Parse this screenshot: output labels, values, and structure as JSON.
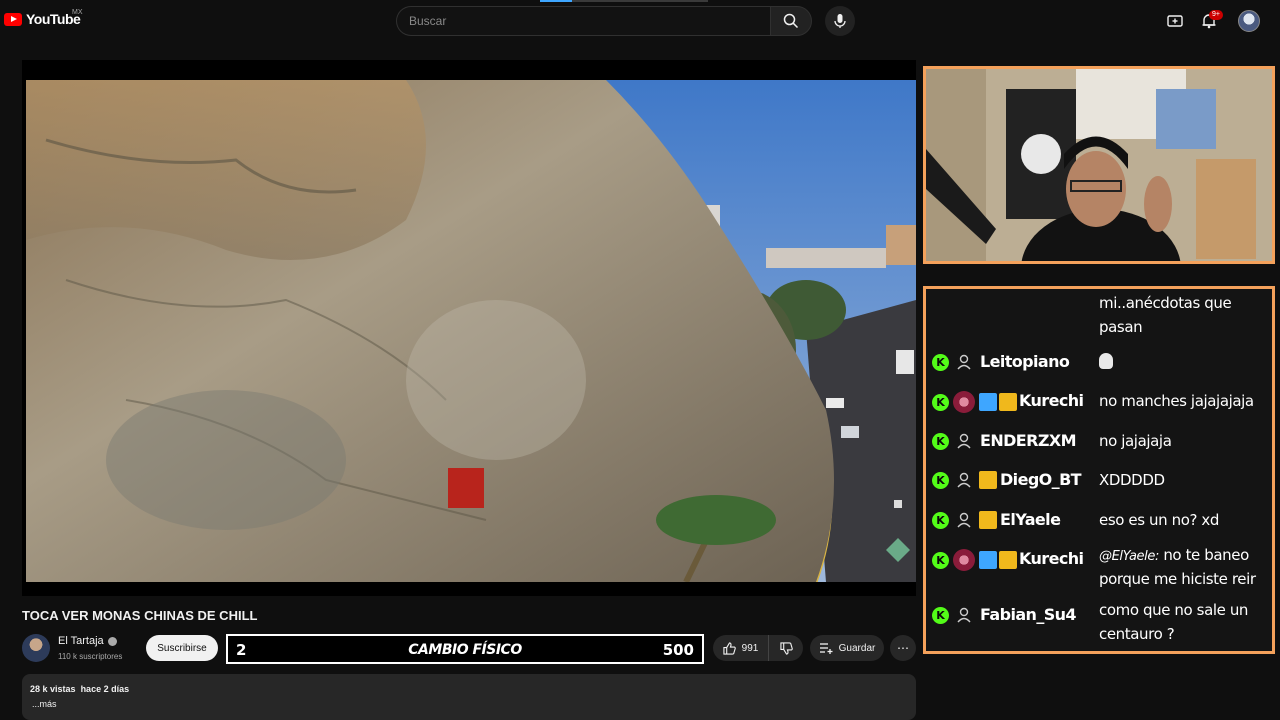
{
  "header": {
    "logo_text": "YouTube",
    "region": "MX",
    "search_placeholder": "Buscar",
    "notif_count": "9+"
  },
  "video": {
    "title": "TOCA VER MONAS CHINAS DE CHILL",
    "channel_name": "El Tartaja",
    "subscribers": "110 k suscriptores",
    "subscribe_label": "Suscribirse",
    "likes": "991",
    "save_label": "Guardar",
    "views": "28 k vistas",
    "age": "hace 2 días",
    "more_label": "...más"
  },
  "overlay_bar": {
    "left": "2",
    "center": "CAMBIO FÍSICO",
    "right": "500"
  },
  "chat": {
    "continuation": [
      "mi..anécdotas que",
      "pasan"
    ],
    "messages": [
      {
        "user": "Leitopiano",
        "text": "",
        "emote": true
      },
      {
        "user": "Kurechi",
        "text": "no manches jajajajaja"
      },
      {
        "user": "ENDERZXM",
        "text": "no jajajaja"
      },
      {
        "user": "DiegO_BT",
        "text": "XDDDDD"
      },
      {
        "user": "ElYaele",
        "text": "eso es un no? xd"
      },
      {
        "user": "Kurechi",
        "mention": "@ElYaele:",
        "text": "no te baneo",
        "text2": "porque me hiciste reir"
      },
      {
        "user": "Fabian_Su4",
        "text": "como que no sale un",
        "text2": "centauro ?"
      }
    ]
  },
  "icons": [
    "search-icon",
    "mic-icon",
    "create-icon",
    "bell-icon",
    "like-icon",
    "dislike-icon",
    "save-icon",
    "more-icon",
    "kick-badge-icon",
    "person-icon",
    "sword-badge-icon",
    "crown-badge-icon"
  ],
  "colors": {
    "background": "#0f0f0f",
    "brand_red": "#ff0000",
    "stream_frame": "#f4a15b",
    "kick_green": "#53fc18",
    "crown": "#f0b81c",
    "sword": "#3ea6ff"
  }
}
